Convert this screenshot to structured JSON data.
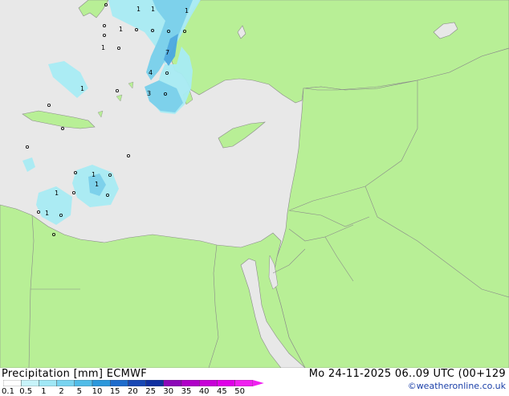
{
  "title": "Precipitation [mm]  ECMWF",
  "datetime": "Mo 24-11-2025 06..09 UTC (00+129",
  "credit": "©weatheronline.co.uk",
  "colors": {
    "land": "#b8ef96",
    "sea": "#e8e8e8",
    "border": "#8a8a8a",
    "precip_light": "#a8ecf4",
    "precip_mid": "#78d0ec",
    "precip_heavy": "#4aa8e0"
  },
  "legend": {
    "ticks": [
      "0.1",
      "0.5",
      "1",
      "2",
      "5",
      "10",
      "15",
      "20",
      "25",
      "30",
      "35",
      "40",
      "45",
      "50"
    ],
    "colors": [
      "#ffffff",
      "#c8f4fa",
      "#a0e8f6",
      "#78d4f0",
      "#50bce8",
      "#2c98dc",
      "#1e6ccc",
      "#1848b4",
      "#1030a0",
      "#8c08b8",
      "#b000c8",
      "#c800d8",
      "#e000e8",
      "#f020f0"
    ]
  },
  "point_labels": [
    {
      "text": "1"
    },
    {
      "text": "1"
    },
    {
      "text": "1"
    },
    {
      "text": "1"
    },
    {
      "text": "1"
    },
    {
      "text": "1"
    },
    {
      "text": "7"
    },
    {
      "text": "4"
    },
    {
      "text": "3"
    },
    {
      "text": "1"
    },
    {
      "text": "1"
    },
    {
      "text": "1"
    },
    {
      "text": "1"
    }
  ]
}
